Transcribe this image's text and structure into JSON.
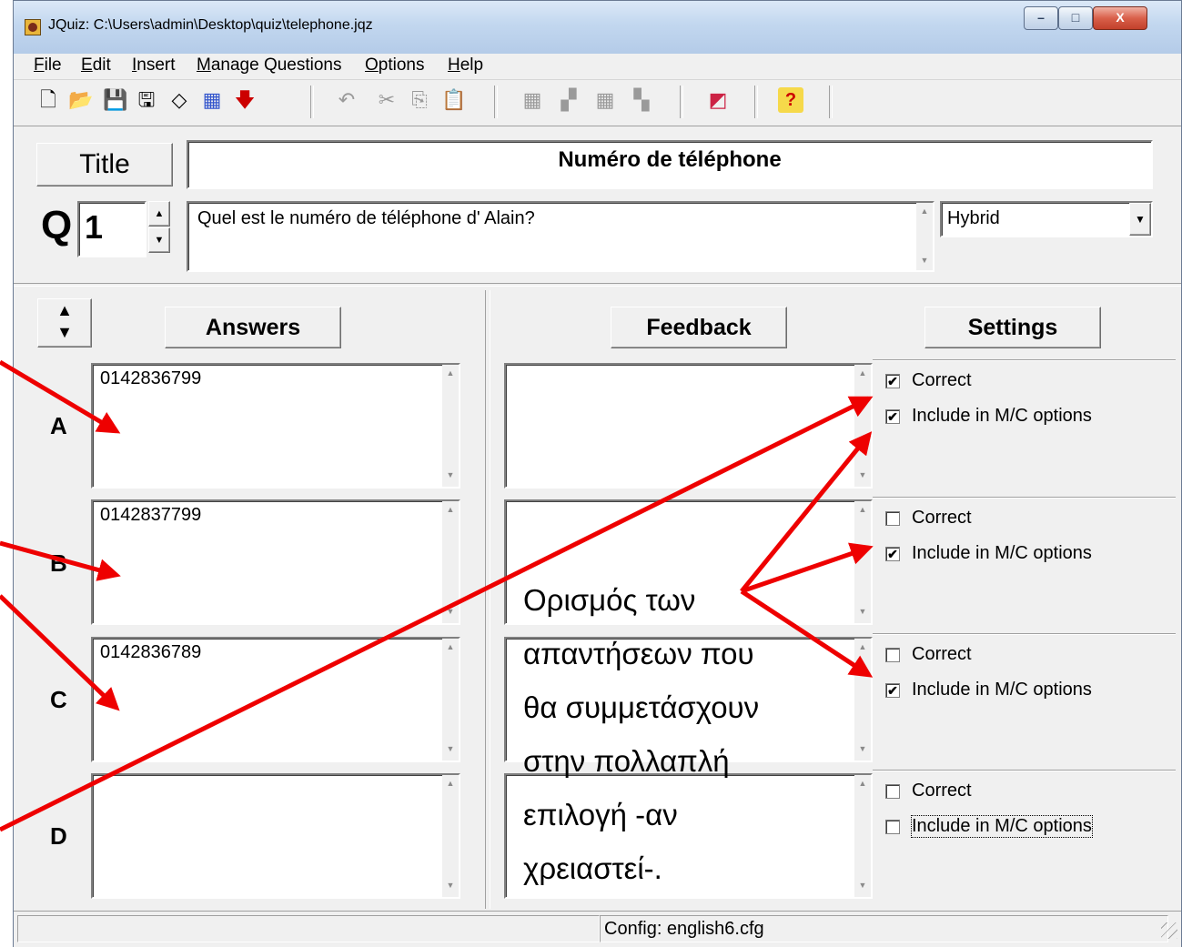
{
  "window": {
    "title": "JQuiz: C:\\Users\\admin\\Desktop\\quiz\\telephone.jqz",
    "minimize": "–",
    "maximize": "□",
    "close": "X"
  },
  "menu": {
    "file_u": "F",
    "file": "ile",
    "edit_u": "E",
    "edit": "dit",
    "insert_u": "I",
    "insert": "nsert",
    "manage_u": "M",
    "manage": "anage Questions",
    "options_u": "O",
    "options": "ptions",
    "help_u": "H",
    "help": "elp"
  },
  "toolbar": {
    "new_glyph": "🗋",
    "open_glyph": "📂",
    "save_glyph": "💾",
    "save_as_glyph": "🖫",
    "eraser_glyph": "◇",
    "export_glyph": "▦",
    "down_glyph": "🡇",
    "undo_glyph": "↶",
    "cut_glyph": "✂",
    "copy_glyph": "⎘",
    "paste_glyph": "📋",
    "w1": "▦",
    "w2": "▞",
    "w3": "▦",
    "w4": "▚",
    "config_glyph": "◩",
    "help_glyph": "?"
  },
  "editor": {
    "title_label": "Title",
    "title_value": "Numéro de téléphone",
    "q_label": "Q",
    "q_number": "1",
    "spin_up": "▲",
    "spin_down": "▼",
    "question_text": "Quel est le numéro de téléphone d' Alain?",
    "question_type": "Hybrid",
    "dropdown_arrow": "▼"
  },
  "columns": {
    "reorder_up": "▲",
    "reorder_down": "▼",
    "answers": "Answers",
    "feedback": "Feedback",
    "settings": "Settings"
  },
  "scroll": {
    "up": "▲",
    "down": "▼"
  },
  "answers": [
    {
      "letter": "A",
      "text": "0142836799",
      "feedback": "",
      "correct": true,
      "correct_mark": "✔",
      "include": true,
      "include_mark": "✔",
      "correct_label": "Correct",
      "include_label": "Include in M/C options"
    },
    {
      "letter": "B",
      "text": "0142837799",
      "feedback": "",
      "correct": false,
      "correct_mark": "",
      "include": true,
      "include_mark": "✔",
      "correct_label": "Correct",
      "include_label": "Include in M/C options"
    },
    {
      "letter": "C",
      "text": "0142836789",
      "feedback": "",
      "correct": false,
      "correct_mark": "",
      "include": true,
      "include_mark": "✔",
      "correct_label": "Correct",
      "include_label": "Include in M/C options"
    },
    {
      "letter": "D",
      "text": "",
      "feedback": "",
      "correct": false,
      "correct_mark": "",
      "include": false,
      "include_mark": "",
      "correct_label": "Correct",
      "include_label": "Include in M/C options"
    }
  ],
  "status": {
    "config": "Config: english6.cfg"
  },
  "annotation": {
    "lines": [
      "Ορισμός των",
      "απαντήσεων που",
      "θα συμμετάσχουν",
      "στην πολλαπλή",
      "επιλογή -αν",
      "χρειαστεί-."
    ],
    "arrow_color": "#ee0000"
  }
}
